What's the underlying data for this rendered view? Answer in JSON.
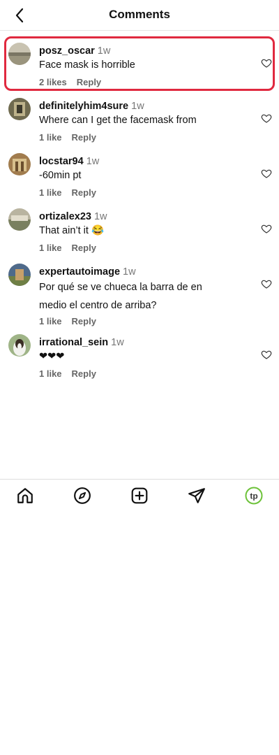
{
  "header": {
    "title": "Comments"
  },
  "comments": [
    {
      "username": "posz_oscar",
      "time": "1w",
      "text": "Face mask is horrible",
      "likes": "2 likes",
      "reply": "Reply",
      "highlighted": true
    },
    {
      "username": "definitelyhim4sure",
      "time": "1w",
      "text": "Where can I get the facemask from",
      "likes": "1 like",
      "reply": "Reply"
    },
    {
      "username": "locstar94",
      "time": "1w",
      "text": "-60min pt",
      "likes": "1 like",
      "reply": "Reply"
    },
    {
      "username": "ortizalex23",
      "time": "1w",
      "text": "That ain’t it 😂",
      "likes": "1 like",
      "reply": "Reply"
    },
    {
      "username": "expertautoimage",
      "time": "1w",
      "text": "Por qué se ve chueca la barra de en medio el centro de arriba?",
      "likes": "1 like",
      "reply": "Reply"
    },
    {
      "username": "irrational_sein",
      "time": "1w",
      "text": "❤❤❤",
      "likes": "1 like",
      "reply": "Reply"
    }
  ],
  "tabbar": {
    "items": [
      "home-icon",
      "explore-compass-icon",
      "create-plus-icon",
      "direct-send-icon",
      "profile-avatar-icon"
    ],
    "profile_initials": "tp",
    "accent": "#6dc23a"
  }
}
